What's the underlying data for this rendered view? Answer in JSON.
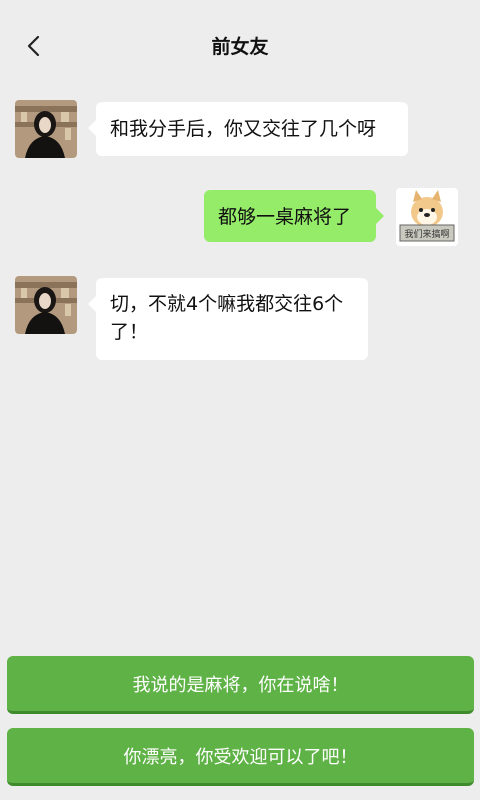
{
  "header": {
    "title": "前女友"
  },
  "messages": [
    {
      "from": "contact",
      "text": "和我分手后，你又交往了几个呀"
    },
    {
      "from": "me",
      "text": "都够一桌麻将了"
    },
    {
      "from": "contact",
      "text": "切，不就4个嘛我都交往6个了！"
    }
  ],
  "meme_caption": "我们来搞啊",
  "choices": [
    "我说的是麻将，你在说啥！",
    "你漂亮，你受欢迎可以了吧！"
  ],
  "colors": {
    "background": "#ededed",
    "outgoing_bubble": "#95ec69",
    "incoming_bubble": "#ffffff",
    "choice_button": "#5fb246"
  }
}
